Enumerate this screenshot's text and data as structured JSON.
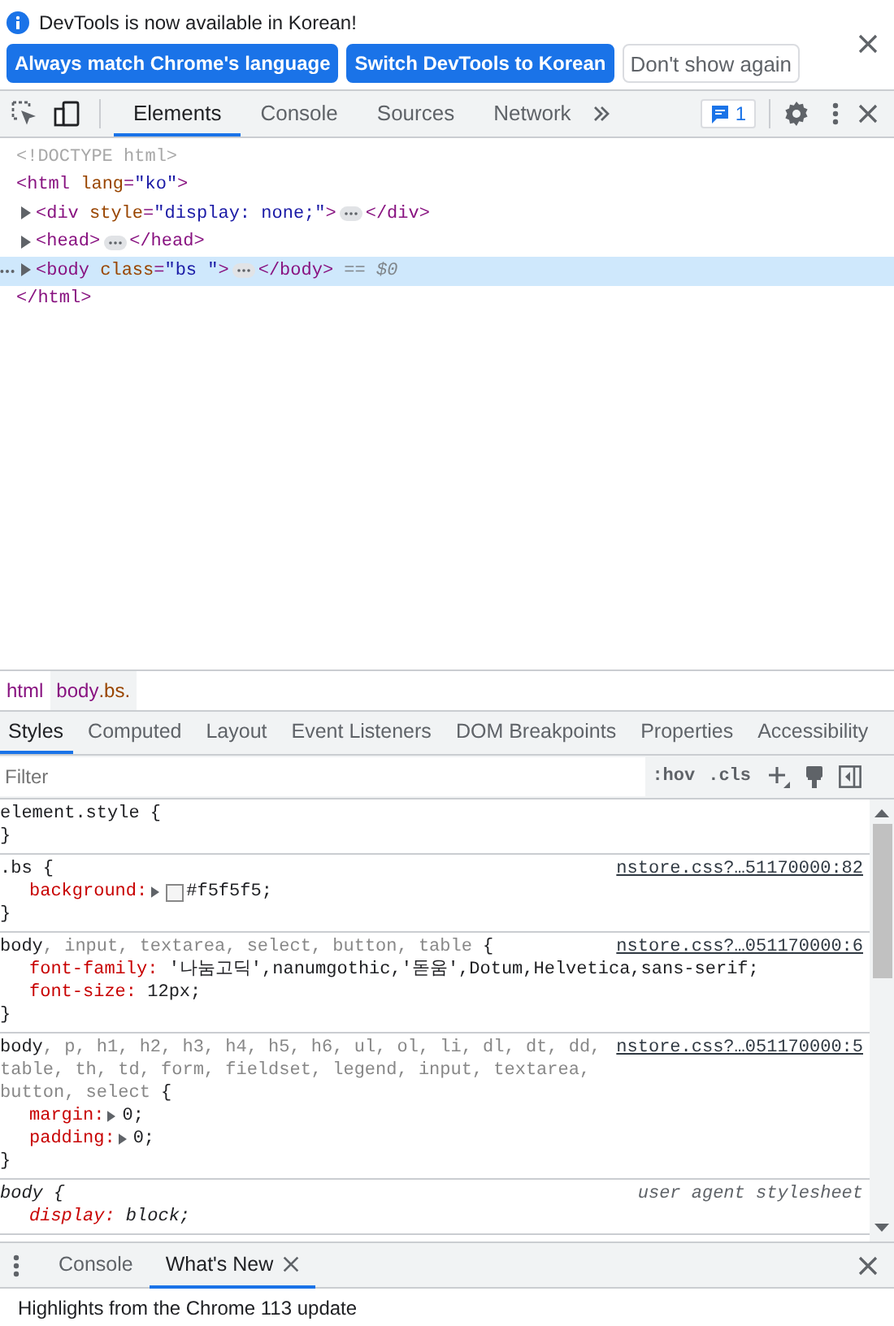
{
  "infobar": {
    "message": "DevTools is now available in Korean!",
    "buttons": [
      {
        "label": "Always match Chrome's language",
        "kind": "primary"
      },
      {
        "label": "Switch DevTools to Korean",
        "kind": "primary"
      },
      {
        "label": "Don't show again",
        "kind": "secondary"
      }
    ]
  },
  "toolbar": {
    "tabs": [
      {
        "label": "Elements",
        "selected": true
      },
      {
        "label": "Console",
        "selected": false
      },
      {
        "label": "Sources",
        "selected": false
      },
      {
        "label": "Network",
        "selected": false
      }
    ],
    "issues_count": "1"
  },
  "dom": [
    {
      "expandable": false,
      "selected": false,
      "tokens": [
        {
          "kind": "doctype",
          "text": "<!DOCTYPE html>"
        }
      ]
    },
    {
      "expandable": false,
      "selected": false,
      "tokens": [
        {
          "kind": "tag",
          "text": "<html"
        },
        {
          "kind": "attr",
          "text": " lang"
        },
        {
          "kind": "tag",
          "text": "="
        },
        {
          "kind": "value",
          "text": "\"ko\""
        },
        {
          "kind": "tag",
          "text": ">"
        }
      ]
    },
    {
      "expandable": true,
      "selected": false,
      "tokens": [
        {
          "kind": "tag",
          "text": "<div"
        },
        {
          "kind": "attr",
          "text": " style"
        },
        {
          "kind": "tag",
          "text": "="
        },
        {
          "kind": "value",
          "text": "\"display: none;\""
        },
        {
          "kind": "tag",
          "text": ">"
        },
        {
          "kind": "more"
        },
        {
          "kind": "tag",
          "text": "</div>"
        }
      ]
    },
    {
      "expandable": true,
      "selected": false,
      "tokens": [
        {
          "kind": "tag",
          "text": "<head>"
        },
        {
          "kind": "more"
        },
        {
          "kind": "tag",
          "text": "</head>"
        }
      ]
    },
    {
      "expandable": true,
      "selected": true,
      "tokens": [
        {
          "kind": "tag",
          "text": "<body"
        },
        {
          "kind": "attr",
          "text": " class"
        },
        {
          "kind": "tag",
          "text": "="
        },
        {
          "kind": "value",
          "text": "\"bs \""
        },
        {
          "kind": "tag",
          "text": ">"
        },
        {
          "kind": "more"
        },
        {
          "kind": "tag",
          "text": "</body>"
        },
        {
          "kind": "hint",
          "text": " == $0"
        }
      ]
    },
    {
      "expandable": false,
      "selected": false,
      "tokens": [
        {
          "kind": "tag",
          "text": "</html>"
        }
      ]
    }
  ],
  "breadcrumbs": [
    {
      "tag": "html",
      "selected": false
    },
    {
      "tag": "body",
      "classes": ".bs.",
      "selected": true
    }
  ],
  "panel_tabs": [
    {
      "label": "Styles",
      "selected": true
    },
    {
      "label": "Computed",
      "selected": false
    },
    {
      "label": "Layout",
      "selected": false
    },
    {
      "label": "Event Listeners",
      "selected": false
    },
    {
      "label": "DOM Breakpoints",
      "selected": false
    },
    {
      "label": "Properties",
      "selected": false
    },
    {
      "label": "Accessibility",
      "selected": false
    }
  ],
  "filter": {
    "placeholder": "Filter",
    "buttons": [
      ":hov",
      ".cls"
    ]
  },
  "rules": [
    {
      "selector": [
        {
          "text": "element.style {",
          "matched": true
        }
      ],
      "user_agent": false,
      "closing": "}"
    },
    {
      "selector": [
        {
          "text": ".bs {",
          "matched": true
        }
      ],
      "source": "nstore.css?…51170000:82",
      "user_agent": false,
      "properties": [
        {
          "name": "background:",
          "value": "#f5f5f5;",
          "expandable": true,
          "swatch": true
        }
      ],
      "closing": "}"
    },
    {
      "selector": [
        {
          "text": "body",
          "matched": true
        },
        {
          "text": ", input, textarea, select, button, table",
          "matched": false
        },
        {
          "text": " {",
          "matched": true
        }
      ],
      "source": "nstore.css?…051170000:6",
      "user_agent": false,
      "properties": [
        {
          "name": "font-family:",
          "value": "'나눔고딕',nanumgothic,'돋움',Dotum,Helvetica,sans-serif;",
          "expandable": false
        },
        {
          "name": "font-size:",
          "value": "12px;",
          "expandable": false
        }
      ],
      "closing": "}"
    },
    {
      "selector": [
        {
          "text": "body",
          "matched": true
        },
        {
          "text": ", p, h1, h2, h3, h4, h5, h6, ul, ol, li, dl, dt, dd, table, th, td, form, fieldset, legend, input, textarea, button, select",
          "matched": false
        },
        {
          "text": " {",
          "matched": true
        }
      ],
      "source": "nstore.css?…051170000:5",
      "user_agent": false,
      "properties": [
        {
          "name": "margin:",
          "value": "0;",
          "expandable": true
        },
        {
          "name": "padding:",
          "value": "0;",
          "expandable": true
        }
      ],
      "closing": "}"
    },
    {
      "selector": [
        {
          "text": "body {",
          "matched": true
        }
      ],
      "source": "user agent stylesheet",
      "user_agent": true,
      "properties": [
        {
          "name": "display:",
          "value": "block;",
          "expandable": false
        }
      ]
    }
  ],
  "drawer": {
    "tabs": [
      {
        "label": "Console",
        "selected": false,
        "closable": false
      },
      {
        "label": "What's New",
        "selected": true,
        "closable": true
      }
    ],
    "content": "Highlights from the Chrome 113 update"
  }
}
